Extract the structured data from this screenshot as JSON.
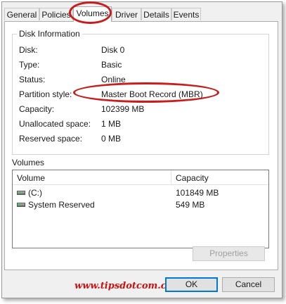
{
  "tabs": [
    {
      "label": "General"
    },
    {
      "label": "Policies"
    },
    {
      "label": "Volumes"
    },
    {
      "label": "Driver"
    },
    {
      "label": "Details"
    },
    {
      "label": "Events"
    }
  ],
  "disk_info": {
    "title": "Disk Information",
    "rows": [
      {
        "label": "Disk:",
        "value": "Disk 0"
      },
      {
        "label": "Type:",
        "value": "Basic"
      },
      {
        "label": "Status:",
        "value": "Online"
      },
      {
        "label": "Partition style:",
        "value": "Master Boot Record (MBR)"
      },
      {
        "label": "Capacity:",
        "value": "102399 MB"
      },
      {
        "label": "Unallocated space:",
        "value": "1 MB"
      },
      {
        "label": "Reserved space:",
        "value": "0 MB"
      }
    ]
  },
  "volumes": {
    "title": "Volumes",
    "col_volume": "Volume",
    "col_capacity": "Capacity",
    "rows": [
      {
        "name": "(C:)",
        "capacity": "101849 MB"
      },
      {
        "name": "System Reserved",
        "capacity": "549 MB"
      }
    ],
    "properties_button": "Properties"
  },
  "footer": {
    "watermark": "www.tipsdotcom.com",
    "ok_button": "OK",
    "cancel_button": "Cancel"
  },
  "colors": {
    "highlight_ellipse": "#c81d1d",
    "watermark": "#cc1111"
  }
}
